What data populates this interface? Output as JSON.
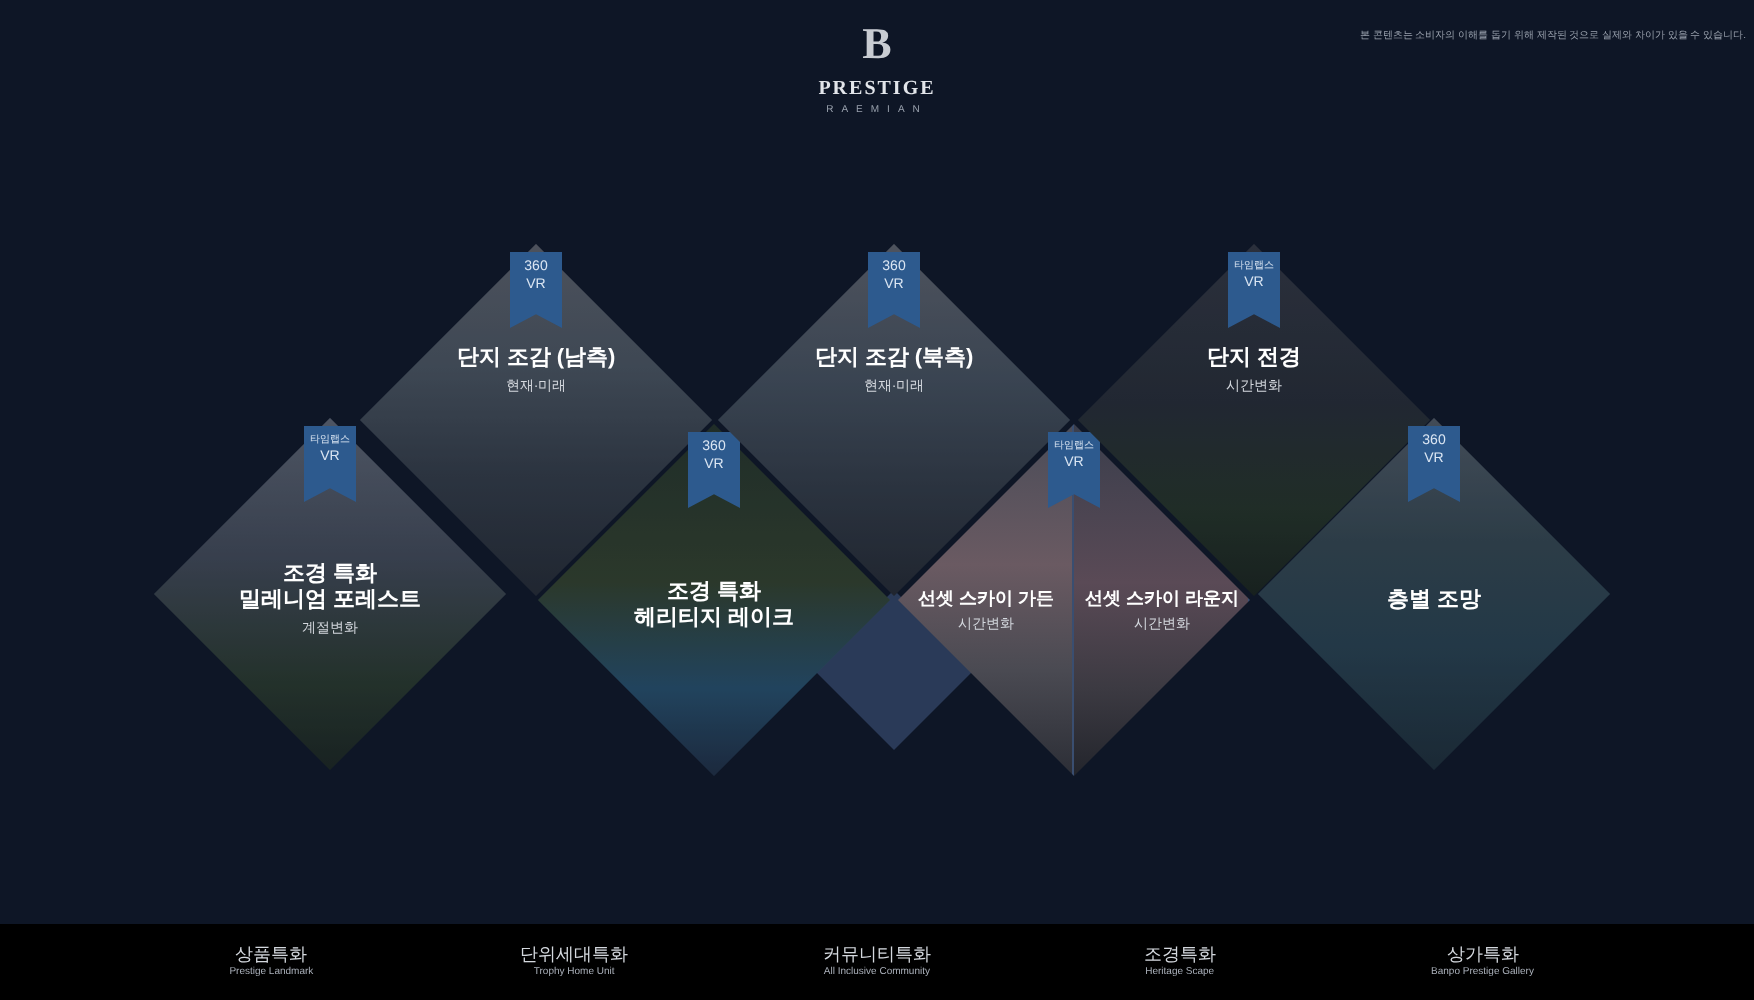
{
  "header": {
    "logo_mark": "B",
    "brand": "PRESTIGE",
    "sub_brand": "RAEMIAN",
    "notice": "본 콘텐츠는 소비자의 이해를 돕기 위해 제작된 것으로 실제와 차이가 있을 수 있습니다."
  },
  "tiles": [
    {
      "kind": "full",
      "badge": [
        "타임랩스",
        "VR"
      ],
      "title": "조경 특화\n밀레니엄 포레스트",
      "subtitle": "계절변화"
    },
    {
      "kind": "full",
      "badge": [
        "360",
        "VR"
      ],
      "title": "단지 조감 (남측)",
      "subtitle": "현재·미래"
    },
    {
      "kind": "full",
      "badge": [
        "360",
        "VR"
      ],
      "title": "조경 특화\n헤리티지 레이크"
    },
    {
      "kind": "full",
      "badge": [
        "360",
        "VR"
      ],
      "title": "단지 조감 (북측)",
      "subtitle": "현재·미래"
    },
    {
      "kind": "split",
      "badge": [
        "타임랩스",
        "VR"
      ],
      "halves": [
        {
          "title": "선셋 스카이 가든",
          "subtitle": "시간변화"
        },
        {
          "title": "선셋 스카이 라운지",
          "subtitle": "시간변화"
        }
      ]
    },
    {
      "kind": "full",
      "badge": [
        "타임랩스",
        "VR"
      ],
      "title": "단지 전경",
      "subtitle": "시간변화"
    },
    {
      "kind": "full",
      "badge": [
        "360",
        "VR"
      ],
      "title": "층별 조망"
    }
  ],
  "footer_nav": [
    {
      "label": "상품특화",
      "sublabel": "Prestige Landmark"
    },
    {
      "label": "단위세대특화",
      "sublabel": "Trophy Home Unit"
    },
    {
      "label": "커뮤니티특화",
      "sublabel": "All Inclusive Community"
    },
    {
      "label": "조경특화",
      "sublabel": "Heritage Scape"
    },
    {
      "label": "상가특화",
      "sublabel": "Banpo Prestige Gallery"
    }
  ]
}
